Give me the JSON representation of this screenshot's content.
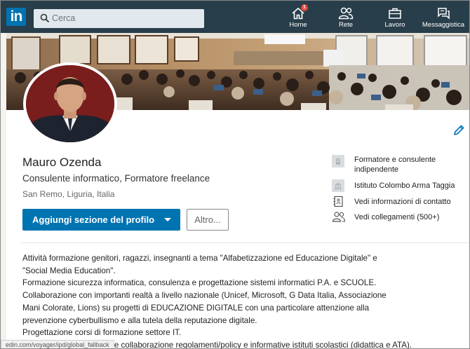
{
  "nav": {
    "logo_text": "in",
    "search_placeholder": "Cerca",
    "items": [
      {
        "label": "Home",
        "icon": "home-icon",
        "badge": "1"
      },
      {
        "label": "Rete",
        "icon": "network-icon"
      },
      {
        "label": "Lavoro",
        "icon": "briefcase-icon"
      },
      {
        "label": "Messaggistica",
        "icon": "messaging-icon"
      }
    ],
    "colors": {
      "bar": "#283e4a",
      "brand": "#0073b1",
      "badge": "#e0483e"
    }
  },
  "profile": {
    "name": "Mauro Ozenda",
    "headline": "Consulente informatico, Formatore freelance",
    "location": "San Remo, Liguria, Italia",
    "add_section_label": "Aggiungi sezione del profilo",
    "more_label": "Altro...",
    "side": {
      "position": "Formatore e consulente indipendente",
      "position_line1": "Formatore e consulente",
      "position_line2": "indipendente",
      "school": "Istituto Colombo Arma Taggia",
      "contact_info": "Vedi informazioni di contatto",
      "connections": "Vedi collegamenti (500+)"
    }
  },
  "about": [
    "Attività formazione genitori, ragazzi, insegnanti a tema \"Alfabetizzazione ed Educazione Digitale\" e",
    "\"Social Media Education\".",
    "Formazione sicurezza informatica, consulenza e progettazione sistemi informatici P.A. e SCUOLE.",
    "Collaborazione con importanti realtà a livello nazionale (Unicef, Microsoft, G Data Italia, Associazione",
    "Mani Colorate, Lions) su progetti di EDUCAZIONE DIGITALE con una particolare attenzione alla",
    "prevenzione cyberbullismo e alla tutela della reputazione digitale.",
    "Progettazione corsi di formazione settore IT.",
    "Gestione implementazione collaborazione regolamenti/policy e informative istituti scolastici (didattica e ATA)."
  ],
  "status_bar": {
    "url": "edin.com/voyager/ipd/global_fallback"
  }
}
